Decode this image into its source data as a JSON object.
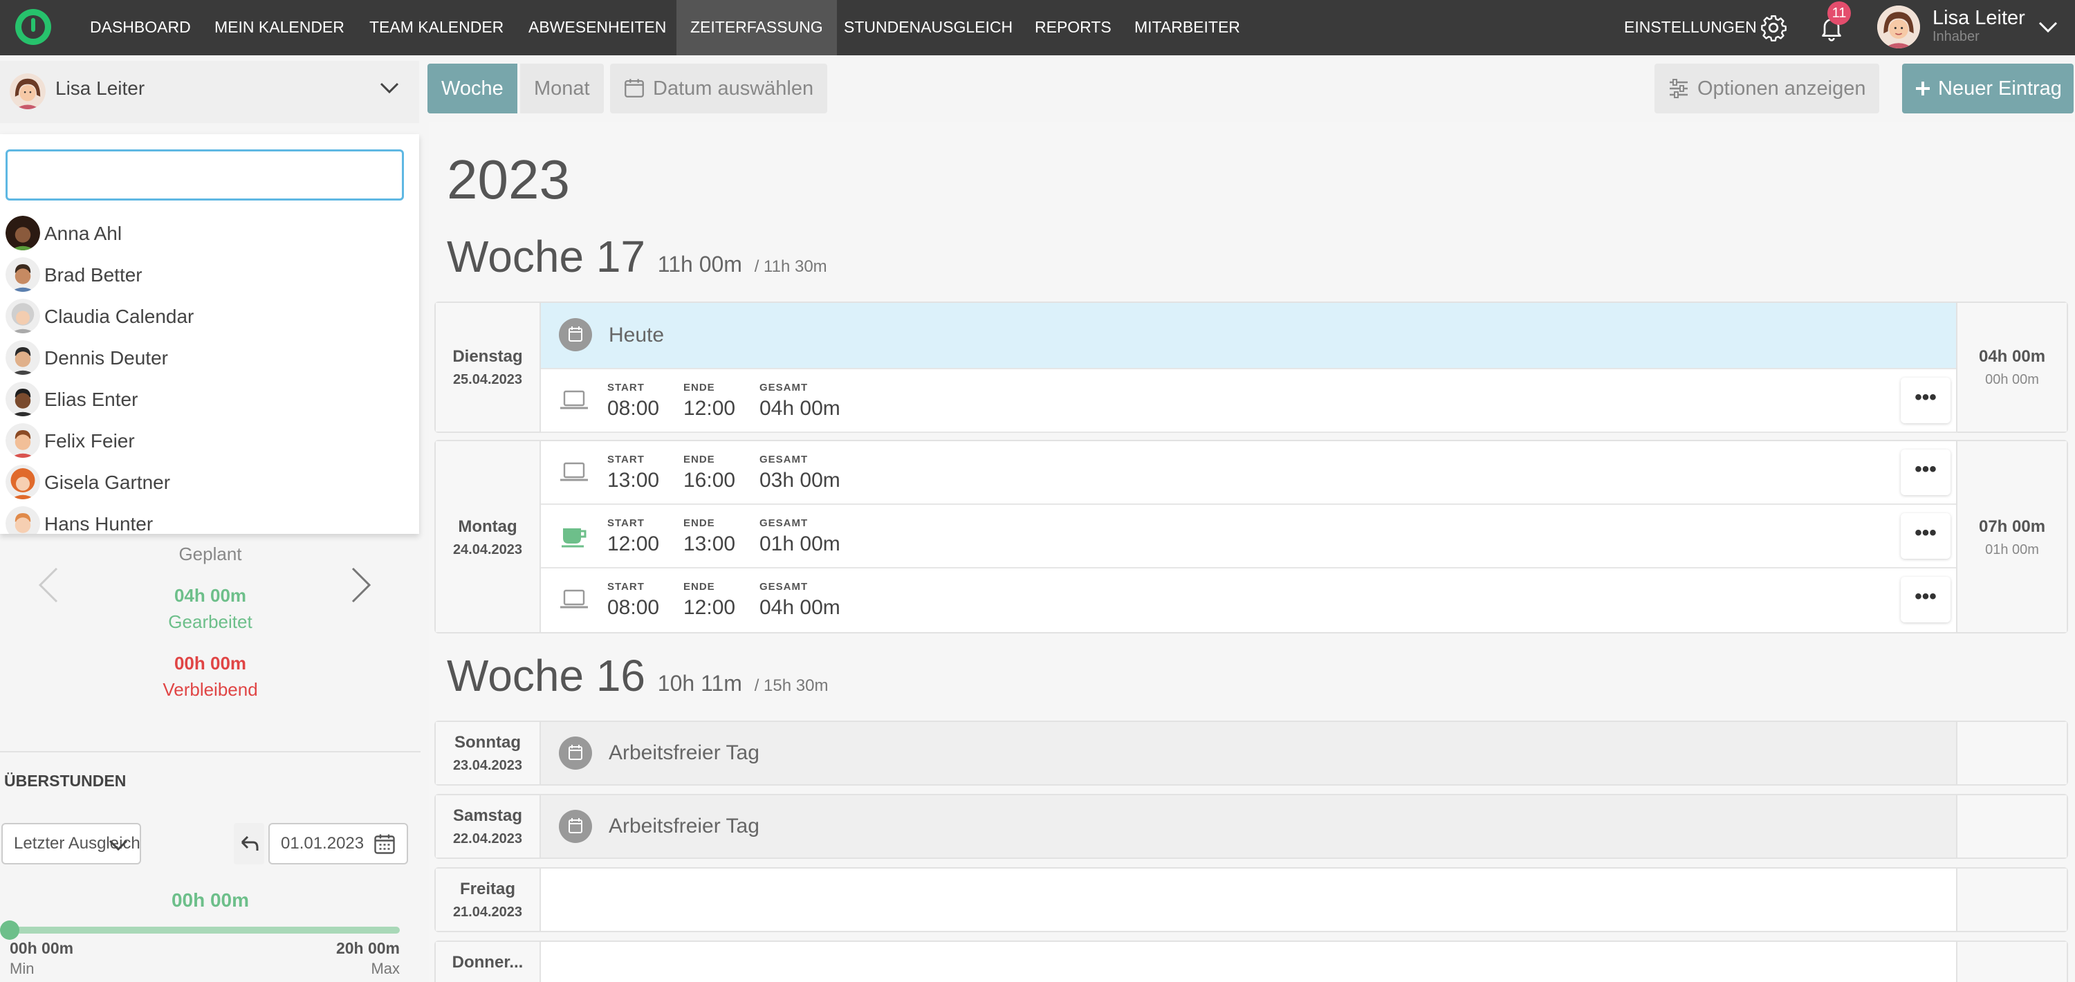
{
  "nav": {
    "items": [
      "DASHBOARD",
      "MEIN KALENDER",
      "TEAM KALENDER",
      "ABWESENHEITEN",
      "ZEITERFASSUNG",
      "STUNDENAUSGLEICH",
      "REPORTS",
      "MITARBEITER"
    ],
    "active": "ZEITERFASSUNG",
    "settings_label": "EINSTELLUNGEN",
    "notification_count": "11",
    "user_name": "Lisa Leiter",
    "user_role": "Inhaber"
  },
  "employee_select": {
    "selected": "Lisa Leiter",
    "search_value": "",
    "options": [
      "Anna Ahl",
      "Brad Better",
      "Claudia Calendar",
      "Dennis Deuter",
      "Elias Enter",
      "Felix Feier",
      "Gisela Gartner",
      "Hans Hunter"
    ]
  },
  "stats": {
    "geplant_label": "Geplant",
    "gearbeitet_value": "04h 00m",
    "gearbeitet_label": "Gearbeitet",
    "verbleibend_value": "00h 00m",
    "verbleibend_label": "Verbleibend"
  },
  "ueberstunden": {
    "title": "ÜBERSTUNDEN",
    "period_select": "Letzter Ausgleich",
    "date": "01.01.2023",
    "value": "00h 00m",
    "min_value": "00h 00m",
    "min_label": "Min",
    "max_value": "20h 00m",
    "max_label": "Max",
    "slider_fraction": 0
  },
  "toolbar": {
    "week": "Woche",
    "month": "Monat",
    "date_pick": "Datum auswählen",
    "options": "Optionen anzeigen",
    "new_entry": "Neuer Eintrag"
  },
  "colors": {
    "topnav": "#3a3a3a",
    "accent": "#78a6ab",
    "green": "#6dbf8a",
    "red": "#e04545",
    "today": "#dcf1fa",
    "badge": "#e44d6d"
  },
  "year": "2023",
  "weeks": [
    {
      "label": "Woche 17",
      "total": "11h 00m",
      "target": "/ 11h 30m"
    },
    {
      "label": "Woche 16",
      "total": "10h 11m",
      "target": "/ 15h 30m"
    }
  ],
  "labels": {
    "start": "START",
    "ende": "ENDE",
    "gesamt": "GESAMT",
    "heute": "Heute",
    "frei": "Arbeitsfreier Tag",
    "more": "•••"
  },
  "days": {
    "dienstag": {
      "name": "Dienstag",
      "date": "25.04.2023",
      "total": "04h 00m",
      "sub": "00h 00m",
      "entries": [
        {
          "icon": "laptop-icon",
          "start": "08:00",
          "ende": "12:00",
          "gesamt": "04h 00m"
        }
      ]
    },
    "montag": {
      "name": "Montag",
      "date": "24.04.2023",
      "total": "07h 00m",
      "sub": "01h 00m",
      "entries": [
        {
          "icon": "laptop-icon",
          "start": "13:00",
          "ende": "16:00",
          "gesamt": "03h 00m"
        },
        {
          "icon": "coffee-icon",
          "start": "12:00",
          "ende": "13:00",
          "gesamt": "01h 00m"
        },
        {
          "icon": "laptop-icon",
          "start": "08:00",
          "ende": "12:00",
          "gesamt": "04h 00m"
        }
      ]
    },
    "sonntag": {
      "name": "Sonntag",
      "date": "23.04.2023"
    },
    "samstag": {
      "name": "Samstag",
      "date": "22.04.2023"
    },
    "freitag": {
      "name": "Freitag",
      "date": "21.04.2023"
    },
    "donnerstag": {
      "name": "Donner..."
    }
  }
}
